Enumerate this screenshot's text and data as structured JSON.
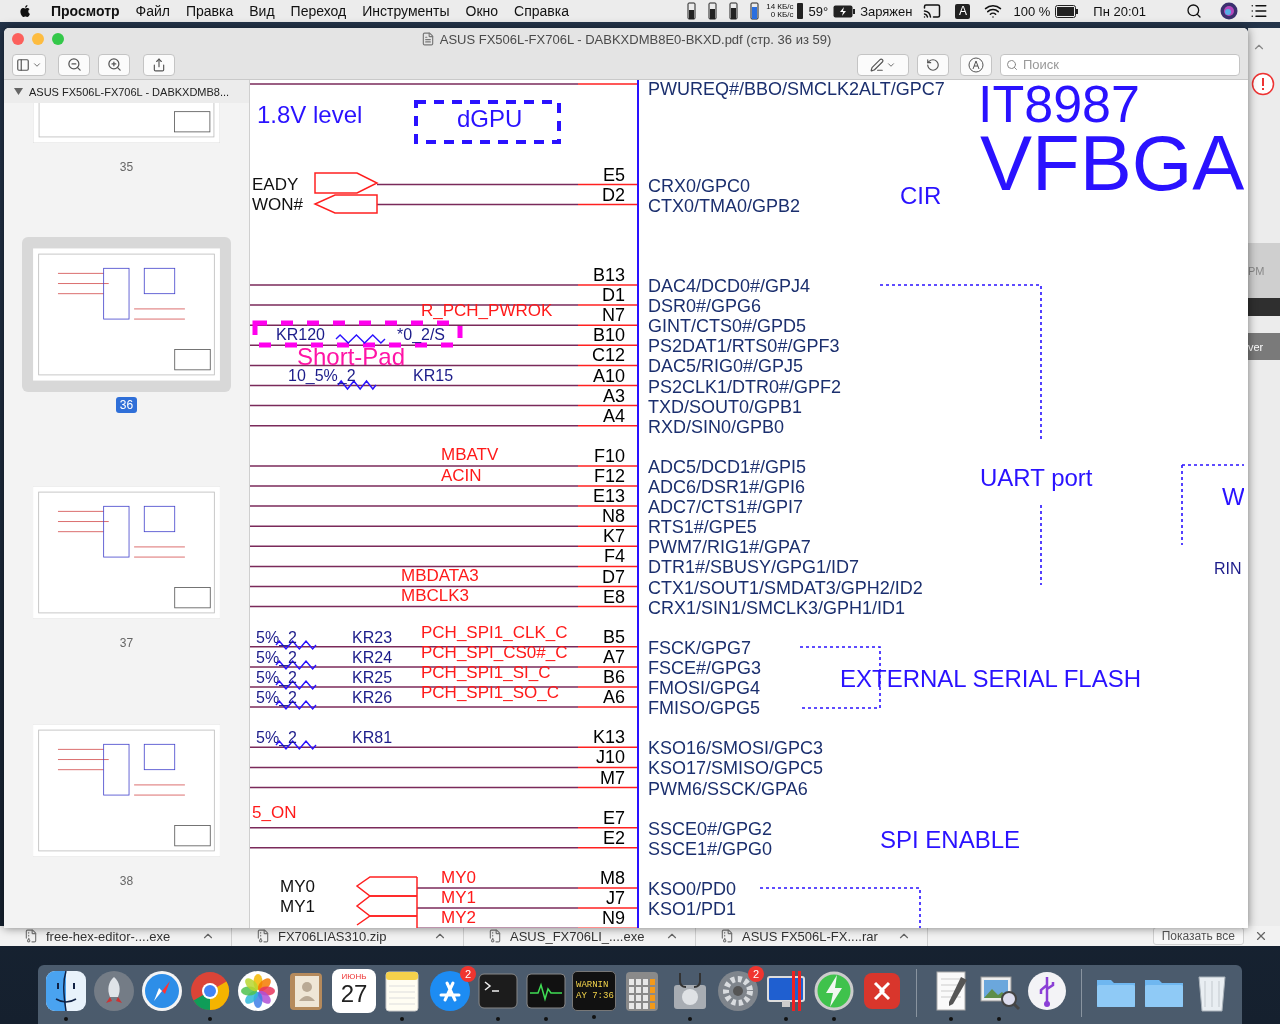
{
  "menu_bar": {
    "app": "Просмотр",
    "items": [
      "Файл",
      "Правка",
      "Вид",
      "Переход",
      "Инструменты",
      "Окно",
      "Справка"
    ],
    "net_up": "14 КБ/с",
    "net_down": "0 КБ/с",
    "temperature": "59°",
    "power_status": "Заряжен",
    "input_source": "A",
    "battery": "100 %",
    "clock": "Пн 20:01"
  },
  "window": {
    "title": "ASUS FX506L-FX706L - DABKXDMB8E0-BKXD.pdf (стр. 36 из 59)",
    "search": {
      "placeholder": "Поиск"
    }
  },
  "sidebar": {
    "document": "ASUS FX506L-FX706L - DABKXDMB8...",
    "expanded": true,
    "pages": [
      {
        "label": "35",
        "selected": false
      },
      {
        "label": "36",
        "selected": true
      },
      {
        "label": "37",
        "selected": false
      },
      {
        "label": "38",
        "selected": false
      }
    ]
  },
  "schematic": {
    "groups": [
      {
        "pins": [
          {
            "function": "PWUREQ#/BBO/SMCLK2ALT/GPC7"
          }
        ]
      },
      {
        "pins": [
          {
            "pin": "E5",
            "function": "CRX0/GPC0"
          },
          {
            "pin": "D2",
            "function": "CTX0/TMA0/GPB2"
          }
        ]
      },
      {
        "pins": [
          {
            "pin": "B13",
            "function": "DAC4/DCD0#/GPJ4"
          },
          {
            "pin": "D1",
            "function": "DSR0#/GPG6"
          },
          {
            "pin": "N7",
            "function": "GINT/CTS0#/GPD5"
          },
          {
            "pin": "B10",
            "function": "PS2DAT1/RTS0#/GPF3"
          },
          {
            "pin": "C12",
            "function": "DAC5/RIG0#/GPJ5"
          },
          {
            "pin": "A10",
            "function": "PS2CLK1/DTR0#/GPF2"
          },
          {
            "pin": "A3",
            "function": "TXD/SOUT0/GPB1"
          },
          {
            "pin": "A4",
            "function": "RXD/SIN0/GPB0"
          }
        ]
      },
      {
        "pins": [
          {
            "pin": "F10",
            "function": "ADC5/DCD1#/GPI5"
          },
          {
            "pin": "F12",
            "function": "ADC6/DSR1#/GPI6"
          },
          {
            "pin": "E13",
            "function": "ADC7/CTS1#/GPI7"
          },
          {
            "pin": "N8",
            "function": "RTS1#/GPE5"
          },
          {
            "pin": "K7",
            "function": "PWM7/RIG1#/GPA7"
          },
          {
            "pin": "F4",
            "function": "DTR1#/SBUSY/GPG1/ID7"
          },
          {
            "pin": "D7",
            "function": "CTX1/SOUT1/SMDAT3/GPH2/ID2"
          },
          {
            "pin": "E8",
            "function": "CRX1/SIN1/SMCLK3/GPH1/ID1"
          }
        ]
      },
      {
        "pins": [
          {
            "pin": "B5",
            "function": "FSCK/GPG7"
          },
          {
            "pin": "A7",
            "function": "FSCE#/GPG3"
          },
          {
            "pin": "B6",
            "function": "FMOSI/GPG4"
          },
          {
            "pin": "A6",
            "function": "FMISO/GPG5"
          }
        ]
      },
      {
        "pins": [
          {
            "pin": "K13",
            "function": "KSO16/SMOSI/GPC3"
          },
          {
            "pin": "J10",
            "function": "KSO17/SMISO/GPC5"
          },
          {
            "pin": "M7",
            "function": "PWM6/SSCK/GPA6"
          }
        ]
      },
      {
        "pins": [
          {
            "pin": "E7",
            "function": "SSCE0#/GPG2"
          },
          {
            "pin": "E2",
            "function": "SSCE1#/GPG0"
          }
        ]
      },
      {
        "pins": [
          {
            "pin": "M8",
            "function": "KSO0/PD0"
          },
          {
            "pin": "J7",
            "function": "KSO1/PD1"
          },
          {
            "pin": "N9"
          }
        ]
      }
    ],
    "annotations": [
      {
        "text": "1.8V level",
        "kind": "note"
      },
      {
        "text": "dGPU",
        "kind": "note"
      },
      {
        "text": "EADY",
        "kind": "signal"
      },
      {
        "text": "WON#",
        "kind": "signal"
      },
      {
        "text": "R_PCH_PWROK",
        "kind": "net"
      },
      {
        "text": "KR120",
        "kind": "part"
      },
      {
        "text": "*0_2/S",
        "kind": "part"
      },
      {
        "text": "Short-Pad",
        "kind": "pad"
      },
      {
        "text": "10_5%_2",
        "kind": "part"
      },
      {
        "text": "KR15",
        "kind": "part"
      },
      {
        "text": "MBATV",
        "kind": "net"
      },
      {
        "text": "ACIN",
        "kind": "net"
      },
      {
        "text": "MBDATA3",
        "kind": "net"
      },
      {
        "text": "MBCLK3",
        "kind": "net"
      },
      {
        "text": "5%_2",
        "kind": "part"
      },
      {
        "text": "KR23",
        "kind": "part"
      },
      {
        "text": "PCH_SPI1_CLK_C",
        "kind": "net"
      },
      {
        "text": "5%_2",
        "kind": "part"
      },
      {
        "text": "KR24",
        "kind": "part"
      },
      {
        "text": "PCH_SPI_CS0#_C",
        "kind": "net"
      },
      {
        "text": "5%_2",
        "kind": "part"
      },
      {
        "text": "KR25",
        "kind": "part"
      },
      {
        "text": "PCH_SPI1_SI_C",
        "kind": "net"
      },
      {
        "text": "5%_2",
        "kind": "part"
      },
      {
        "text": "KR26",
        "kind": "part"
      },
      {
        "text": "PCH_SPI1_SO_C",
        "kind": "net"
      },
      {
        "text": "5%_2",
        "kind": "part"
      },
      {
        "text": "KR81",
        "kind": "part"
      },
      {
        "text": "5_ON",
        "kind": "net"
      },
      {
        "text": "MY0",
        "kind": "signal"
      },
      {
        "text": "MY1",
        "kind": "signal"
      },
      {
        "text": "MY0",
        "kind": "net"
      },
      {
        "text": "MY1",
        "kind": "net"
      },
      {
        "text": "MY2",
        "kind": "net"
      },
      {
        "text": "IT8987",
        "kind": "chip"
      },
      {
        "text": "VFBGA",
        "kind": "package"
      },
      {
        "text": "CIR",
        "kind": "note"
      },
      {
        "text": "UART port",
        "kind": "note"
      },
      {
        "text": "W",
        "kind": "note"
      },
      {
        "text": "RIN",
        "kind": "part"
      },
      {
        "text": "EXTERNAL SERIAL FLASH",
        "kind": "note"
      },
      {
        "text": "SPI ENABLE",
        "kind": "note"
      }
    ]
  },
  "background_window": {
    "texts": [
      "PM",
      "ver"
    ]
  },
  "downloads": {
    "items": [
      "free-hex-editor-....exe",
      "FX706LIAS310.zip",
      "ASUS_FX706LI_....exe",
      "ASUS FX506L-FX....rar"
    ],
    "show_all": "Показать все"
  },
  "dock": {
    "items": [
      {
        "kind": "finder",
        "running": true
      },
      {
        "kind": "launchpad",
        "running": false
      },
      {
        "kind": "safari",
        "running": false
      },
      {
        "kind": "chrome",
        "running": true
      },
      {
        "kind": "photos",
        "running": false
      },
      {
        "kind": "contacts",
        "running": false
      },
      {
        "kind": "calendar",
        "running": false,
        "month": "ИЮНЬ",
        "day": "27"
      },
      {
        "kind": "notes",
        "running": true
      },
      {
        "kind": "appstore",
        "running": false,
        "badge": "2"
      },
      {
        "kind": "terminal",
        "running": true
      },
      {
        "kind": "activity",
        "running": true
      },
      {
        "kind": "console",
        "running": true,
        "lines": [
          "WARNIN",
          "AY 7:36"
        ]
      },
      {
        "kind": "calculator",
        "running": false
      },
      {
        "kind": "diskutility",
        "running": true
      },
      {
        "kind": "settings",
        "running": false,
        "badge": "2"
      },
      {
        "kind": "display",
        "running": true
      },
      {
        "kind": "network",
        "running": true
      },
      {
        "kind": "remote",
        "running": false
      },
      {
        "kind": "separator"
      },
      {
        "kind": "textedit",
        "running": true
      },
      {
        "kind": "preview",
        "running": true
      },
      {
        "kind": "usb",
        "running": false
      },
      {
        "kind": "separator"
      },
      {
        "kind": "folder",
        "running": false
      },
      {
        "kind": "folder",
        "running": false
      },
      {
        "kind": "trash",
        "running": false
      }
    ]
  }
}
